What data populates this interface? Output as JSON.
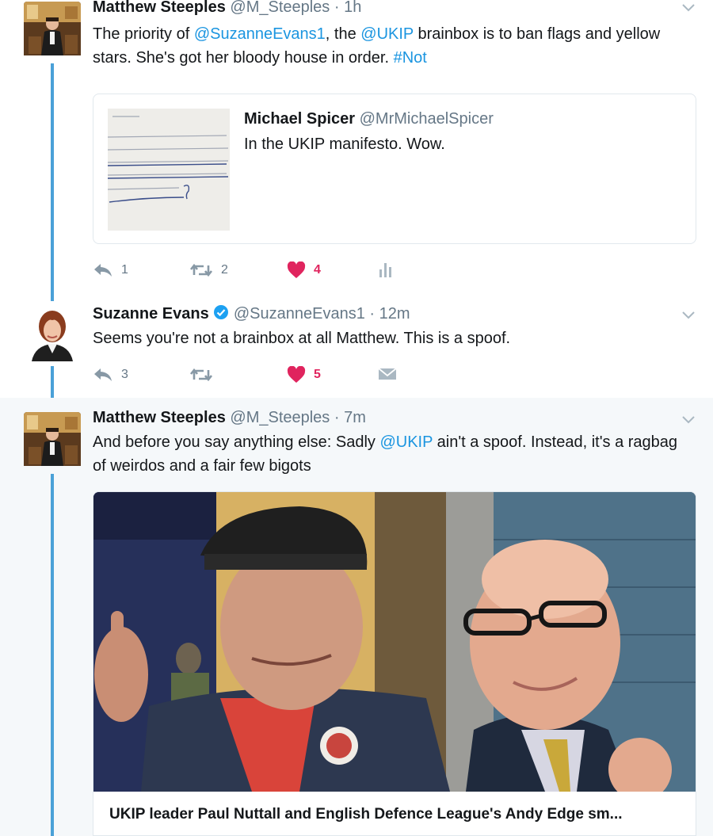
{
  "tweets": [
    {
      "name": "Matthew Steeples",
      "handle": "@M_Steeples",
      "separator": "·",
      "time": "1h",
      "text_parts": [
        "The priority of ",
        "@SuzanneEvans1",
        ", the ",
        "@UKIP",
        " brainbox is to ban flags and yellow stars. She's got her bloody house in order. ",
        "#Not"
      ],
      "quote": {
        "name": "Michael Spicer",
        "handle": "@MrMichaelSpicer",
        "text": "In the UKIP manifesto. Wow."
      },
      "actions": {
        "replies": "1",
        "retweets": "2",
        "likes": "4"
      }
    },
    {
      "name": "Suzanne Evans",
      "handle": "@SuzanneEvans1",
      "separator": "·",
      "time": "12m",
      "text": "Seems you're not a brainbox at all Matthew. This is a spoof.",
      "actions": {
        "replies": "3",
        "likes": "5"
      }
    },
    {
      "name": "Matthew Steeples",
      "handle": "@M_Steeples",
      "separator": "·",
      "time": "7m",
      "text_parts": [
        "And before you say anything else: Sadly ",
        "@UKIP",
        " ain't a spoof. Instead, it's a ragbag of weirdos and a fair few bigots"
      ],
      "media_caption": "UKIP leader Paul Nuttall and English Defence League's Andy Edge sm..."
    }
  ],
  "colors": {
    "link": "#1b95e0",
    "like": "#e0245e",
    "thread": "#4aa1d8",
    "muted": "#657786"
  },
  "icons": [
    "reply-icon",
    "retweet-icon",
    "like-icon",
    "analytics-icon",
    "direct-message-icon",
    "chevron-down-icon",
    "verified-icon"
  ]
}
